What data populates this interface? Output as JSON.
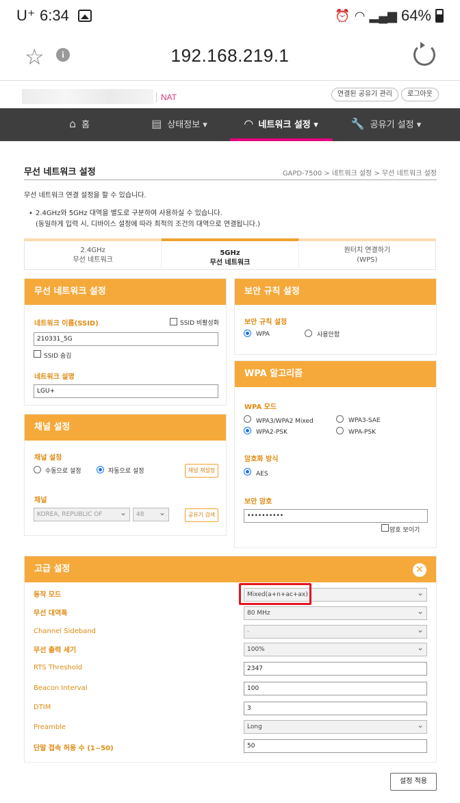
{
  "status_bar": {
    "carrier": "U⁺",
    "time": "6:34",
    "battery": "64%"
  },
  "browser": {
    "url": "192.168.219.1"
  },
  "router_header": {
    "mode": "NAT",
    "btn_connected": "연결된 공유기 관리",
    "btn_logout": "로그아웃"
  },
  "nav": {
    "items": [
      {
        "label": "홈",
        "icon": "home-icon"
      },
      {
        "label": "상태정보 ▾",
        "icon": "document-icon"
      },
      {
        "label": "네트워크 설정 ▾",
        "icon": "wifi-icon"
      },
      {
        "label": "공유기 설정 ▾",
        "icon": "wrench-icon"
      }
    ]
  },
  "page": {
    "title": "무선 네트워크 설정",
    "breadcrumb": "GAPD-7500 > 네트워크 설정 > 무선 네트워크 설정",
    "description": "무선 네트워크 연결 설정을 할 수 있습니다.",
    "note_line1": "2.4GHz와 5GHz 대역을 별도로 구분하여 사용하실 수 있습니다.",
    "note_line2": "(동일하게 입력 시, 디바이스 설정에 따라 최적의 조건의 대역으로 연결됩니다.)"
  },
  "tabs": [
    {
      "line1": "2.4GHz",
      "line2": "무선 네트워크"
    },
    {
      "line1": "5GHz",
      "line2": "무선 네트워크"
    },
    {
      "line1": "원터치 연결하기",
      "line2": "(WPS)"
    }
  ],
  "wireless": {
    "header": "무선 네트워크 설정",
    "ssid_label": "네트워크 이름(SSID)",
    "ssid_disable": "SSID 비활성화",
    "ssid_value": "210331_5G",
    "ssid_hide": "SSID 숨김",
    "desc_label": "네트워크 설명",
    "desc_value": "LGU+"
  },
  "channel": {
    "header": "채널 설정",
    "setting_label": "채널 설정",
    "manual": "수동으로 설정",
    "auto": "자동으로 설정",
    "reset_btn": "채널 재설정",
    "channel_label": "채널",
    "country": "KOREA, REPUBLIC OF",
    "channel_value": "48",
    "search_btn": "공유기 검색"
  },
  "security": {
    "header": "보안 규칙 설정",
    "label": "보안 규칙 설정",
    "opt_wpa": "WPA",
    "opt_none": "사용안함"
  },
  "wpa": {
    "header": "WPA 알고리즘",
    "mode_label": "WPA 모드",
    "opt_wpa3_mixed": "WPA3/WPA2 Mixed",
    "opt_wpa3_sae": "WPA3-SAE",
    "opt_wpa2_psk": "WPA2-PSK",
    "opt_wpa_psk": "WPA-PSK",
    "enc_label": "암호화 방식",
    "enc_aes": "AES",
    "pw_label": "보안 암호",
    "pw_value": "••••••••••",
    "show_pw": "암호 보이기"
  },
  "advanced": {
    "header": "고급 설정",
    "rows": [
      {
        "label": "동작 모드",
        "value": "Mixed(a+n+ac+ax)"
      },
      {
        "label": "무선 대역폭",
        "value": "80 MHz"
      },
      {
        "label": "Channel Sideband",
        "value": "-"
      },
      {
        "label": "무선 출력 세기",
        "value": "100%"
      },
      {
        "label": "RTS Threshold",
        "value": "2347"
      },
      {
        "label": "Beacon Interval",
        "value": "100"
      },
      {
        "label": "DTIM",
        "value": "3"
      },
      {
        "label": "Preamble",
        "value": "Long"
      },
      {
        "label": "단말 접속 허용 수 (1~50)",
        "value": "50"
      }
    ],
    "apply_btn": "설정 적용"
  },
  "colors": {
    "accent": "#f5a93a",
    "nav_bg": "#3e3e3e",
    "nav_active": "#e6007e",
    "highlight": "#e5141f"
  }
}
